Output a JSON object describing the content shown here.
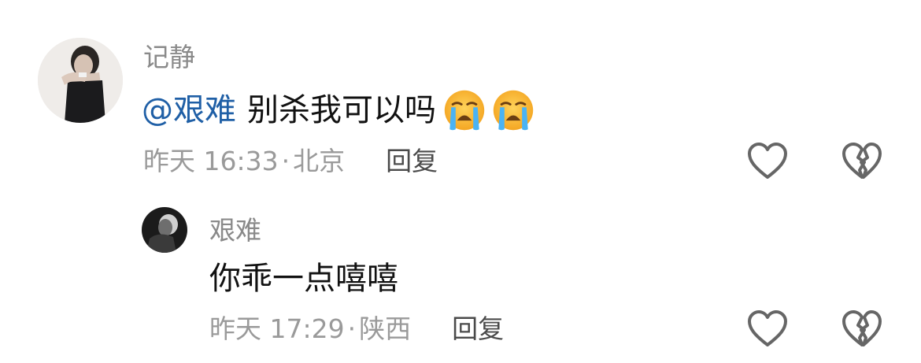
{
  "comment": {
    "author": "记静",
    "mention": "@艰难",
    "text": "别杀我可以吗",
    "emojis": [
      "loudly-crying-face-emoji",
      "loudly-crying-face-emoji"
    ],
    "time": "昨天 16:33",
    "location_sep": "·",
    "location": "北京",
    "reply_label": "回复",
    "like_icon": "heart-outline-icon",
    "dislike_icon": "broken-heart-icon"
  },
  "reply": {
    "author": "艰难",
    "text": "你乖一点嘻嘻",
    "time": "昨天 17:29",
    "location_sep": "·",
    "location": "陕西",
    "reply_label": "回复",
    "like_icon": "heart-outline-icon",
    "dislike_icon": "broken-heart-icon"
  },
  "colors": {
    "mention": "#1f5fa6",
    "meta": "#9a9a9a",
    "reply_button": "#4a4a4a",
    "icon_stroke": "#666666"
  }
}
